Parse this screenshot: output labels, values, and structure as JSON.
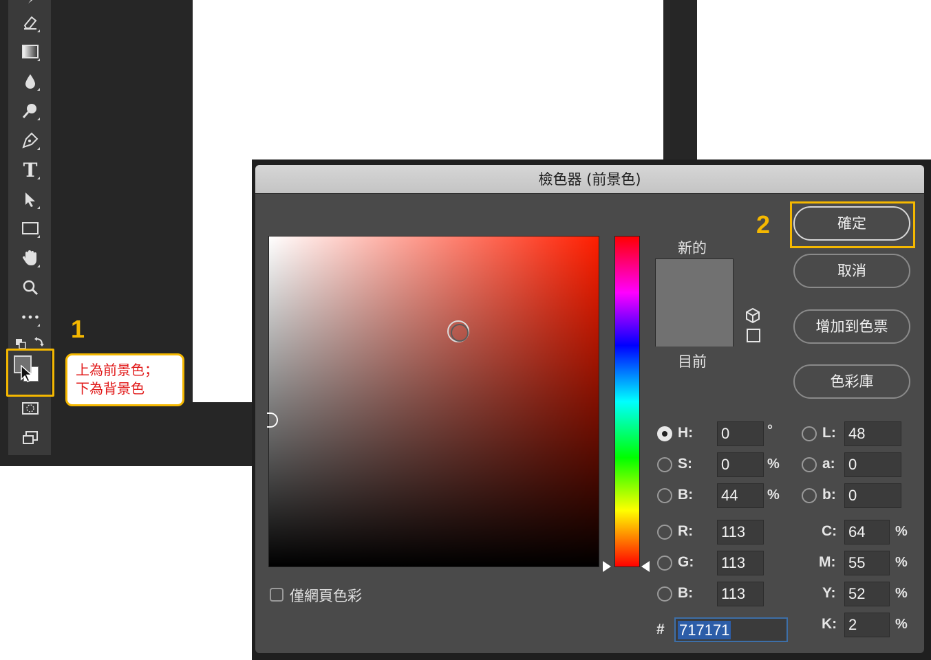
{
  "annotations": {
    "step1": "1",
    "step2": "2",
    "callout_line1": "上為前景色；",
    "callout_line2": "下為背景色"
  },
  "toolbar": {
    "tools": [
      "eraser-icon",
      "gradient-icon",
      "blur-icon",
      "dodge-icon",
      "pen-icon",
      "type-icon",
      "path-selection-icon",
      "rectangle-icon",
      "hand-icon",
      "zoom-icon",
      "more-icon"
    ],
    "type_glyph": "T",
    "more_glyph": "•••",
    "foreground_color": "#717171",
    "background_color": "#ffffff"
  },
  "dialog": {
    "title": "檢色器 (前景色)",
    "new_label": "新的",
    "current_label": "目前",
    "new_color": "#717171",
    "current_color": "#717171",
    "buttons": {
      "ok": "確定",
      "cancel": "取消",
      "add_to_swatches": "增加到色票",
      "color_libraries": "色彩庫"
    },
    "web_colors_only": "僅網頁色彩",
    "fields": {
      "H": {
        "label": "H:",
        "value": "0",
        "unit": "°"
      },
      "S": {
        "label": "S:",
        "value": "0",
        "unit": "%"
      },
      "B": {
        "label": "B:",
        "value": "44",
        "unit": "%"
      },
      "R": {
        "label": "R:",
        "value": "113"
      },
      "G": {
        "label": "G:",
        "value": "113"
      },
      "B2": {
        "label": "B:",
        "value": "113"
      },
      "L": {
        "label": "L:",
        "value": "48"
      },
      "a": {
        "label": "a:",
        "value": "0"
      },
      "b": {
        "label": "b:",
        "value": "0"
      },
      "C": {
        "label": "C:",
        "value": "64",
        "unit": "%"
      },
      "M": {
        "label": "M:",
        "value": "55",
        "unit": "%"
      },
      "Y": {
        "label": "Y:",
        "value": "52",
        "unit": "%"
      },
      "K": {
        "label": "K:",
        "value": "2",
        "unit": "%"
      }
    },
    "hex_label": "#",
    "hex_value": "717171"
  },
  "colors": {
    "highlight": "#f5b800",
    "callout_text": "#e11818"
  }
}
